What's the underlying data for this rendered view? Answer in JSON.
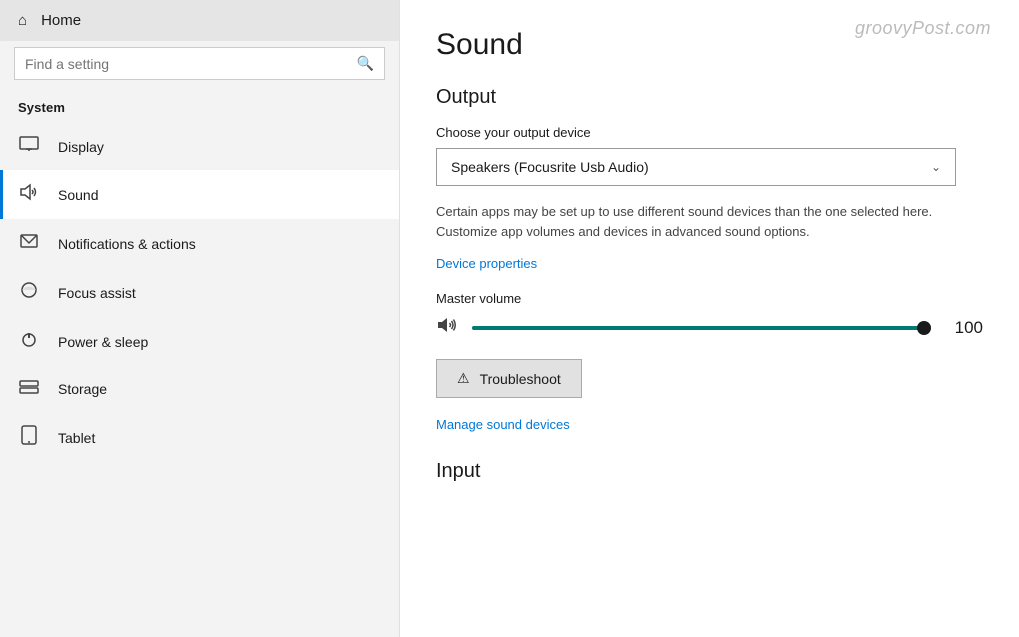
{
  "sidebar": {
    "home_label": "Home",
    "search_placeholder": "Find a setting",
    "system_label": "System",
    "items": [
      {
        "id": "display",
        "label": "Display",
        "icon": "display"
      },
      {
        "id": "sound",
        "label": "Sound",
        "icon": "sound",
        "active": true
      },
      {
        "id": "notifications",
        "label": "Notifications & actions",
        "icon": "notif"
      },
      {
        "id": "focus",
        "label": "Focus assist",
        "icon": "focus"
      },
      {
        "id": "power",
        "label": "Power & sleep",
        "icon": "power"
      },
      {
        "id": "storage",
        "label": "Storage",
        "icon": "storage"
      },
      {
        "id": "tablet",
        "label": "Tablet",
        "icon": "tablet"
      }
    ]
  },
  "main": {
    "watermark": "groovyPost.com",
    "page_title": "Sound",
    "output_section": "Output",
    "choose_output_label": "Choose your output device",
    "selected_device": "Speakers (Focusrite Usb Audio)",
    "description": "Certain apps may be set up to use different sound devices than the one selected here. Customize app volumes and devices in advanced sound options.",
    "device_properties_link": "Device properties",
    "master_volume_label": "Master volume",
    "volume_value": "100",
    "troubleshoot_label": "Troubleshoot",
    "manage_devices_link": "Manage sound devices",
    "input_section": "Input"
  }
}
